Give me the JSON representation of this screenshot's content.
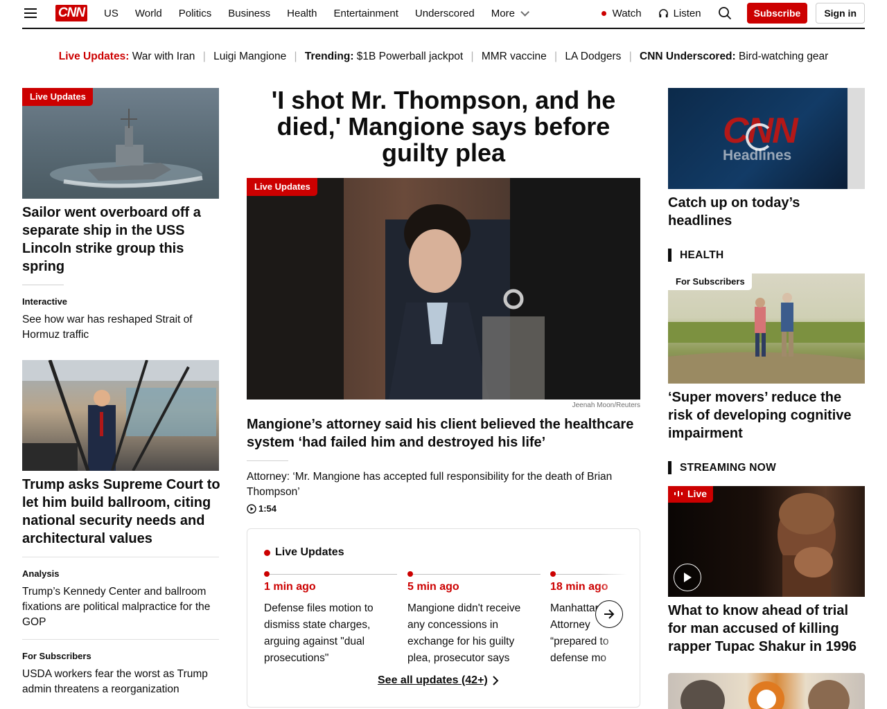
{
  "header": {
    "logo": "CNN",
    "nav": [
      "US",
      "World",
      "Politics",
      "Business",
      "Health",
      "Entertainment",
      "Underscored"
    ],
    "more": "More",
    "watch": "Watch",
    "listen": "Listen",
    "subscribe": "Subscribe",
    "sign_in": "Sign in"
  },
  "trending": {
    "live_label": "Live Updates:",
    "live_link": "War with Iran",
    "link1": "Luigi Mangione",
    "trending_label": "Trending:",
    "link2": "$1B Powerball jackpot",
    "link3": "MMR vaccine",
    "link4": "LA Dodgers",
    "underscored_label": "CNN Underscored:",
    "link5": "Bird-watching gear"
  },
  "left": {
    "story1": {
      "badge": "Live Updates",
      "headline": "Sailor went overboard off a separate ship in the USS Lincoln strike group this spring"
    },
    "story2": {
      "kicker": "Interactive",
      "text": "See how war has reshaped Strait of Hormuz traffic"
    },
    "story3": {
      "headline": "Trump asks Supreme Court to let him build ballroom, citing national security needs and architectural values"
    },
    "story4": {
      "kicker": "Analysis",
      "text": "Trump’s Kennedy Center and ballroom fixations are political malpractice for the GOP"
    },
    "story5": {
      "kicker": "For Subscribers",
      "text": "USDA workers fear the worst as Trump admin threatens a reorganization"
    }
  },
  "center": {
    "title": "'I shot Mr. Thompson, and he died,' Mangione says before guilty plea",
    "badge": "Live Updates",
    "credit": "Jeenah Moon/Reuters",
    "headline": "Mangione’s attorney said his client believed the healthcare system ‘had failed him and destroyed his life’",
    "video_text": "Attorney: ‘Mr. Mangione has accepted full responsibility for the death of Brian Thompson’",
    "duration": "1:54",
    "live": {
      "label": "Live Updates",
      "updates": [
        {
          "time": "1 min ago",
          "text": "Defense files motion to dismiss state charges, arguing against \"dual prosecutions\""
        },
        {
          "time": "5 min ago",
          "text": "Mangione didn't receive any concessions in exchange for his guilty plea, prosecutor says"
        },
        {
          "time": "18 min ago",
          "text": "Manhattan Attorney “prepared to defense mo"
        }
      ],
      "see_all": "See all updates (42+)"
    }
  },
  "right": {
    "video": {
      "logo_text": "CNN",
      "logo_sub": "Headlines",
      "headline": "Catch up on today’s headlines"
    },
    "health": {
      "section": "HEALTH",
      "badge": "For Subscribers",
      "headline": "‘Super movers’ reduce the risk of developing cognitive impairment"
    },
    "streaming": {
      "section": "STREAMING NOW",
      "badge": "Live",
      "headline": "What to know ahead of trial for man accused of killing rapper Tupac Shakur in 1996"
    }
  },
  "colors": {
    "accent": "#cc0000",
    "text": "#0c0c0c"
  }
}
